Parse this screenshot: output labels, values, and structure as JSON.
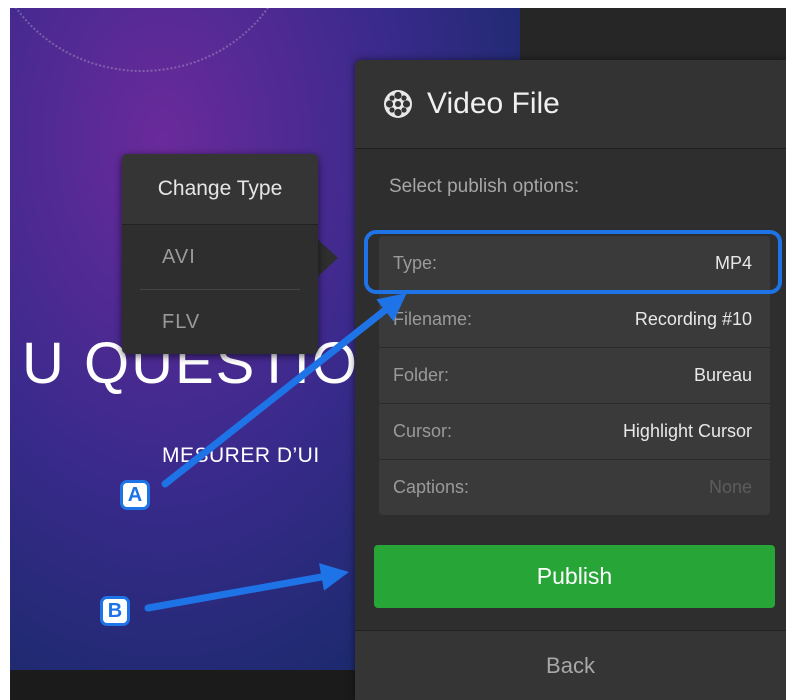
{
  "background": {
    "slide_title": "U QUESTIO",
    "slide_subtitle": "MESURER D’UI"
  },
  "panel": {
    "title": "Video File",
    "icon": "film-reel-icon",
    "subtitle": "Select publish options:",
    "options": [
      {
        "label": "Type:",
        "value": "MP4"
      },
      {
        "label": "Filename:",
        "value": "Recording #10"
      },
      {
        "label": "Folder:",
        "value": "Bureau"
      },
      {
        "label": "Cursor:",
        "value": "Highlight Cursor"
      },
      {
        "label": "Captions:",
        "value": "None"
      }
    ],
    "publish_label": "Publish",
    "back_label": "Back"
  },
  "change_type_popup": {
    "title": "Change Type",
    "items": [
      "AVI",
      "FLV"
    ]
  },
  "annotations": {
    "marker_a": "A",
    "marker_b": "B"
  },
  "colors": {
    "accent_blue": "#1e73e6",
    "publish_green": "#27a637",
    "panel_bg": "#2e2e2e"
  }
}
